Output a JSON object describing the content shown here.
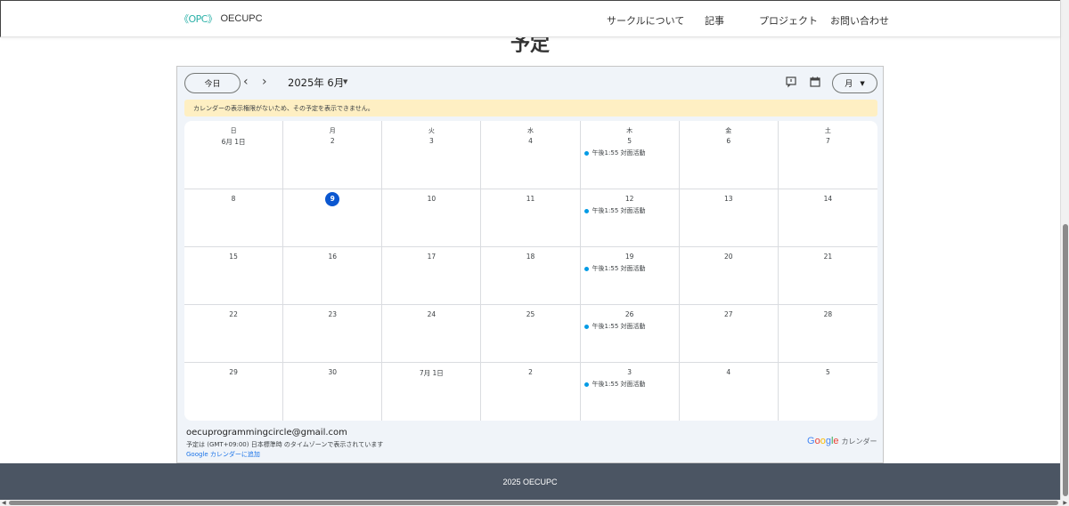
{
  "header": {
    "logo_mark": "《OPC》",
    "logo_text": "OECUPC",
    "nav": [
      "サークルについて",
      "記事",
      "プロジェクト",
      "お問い合わせ"
    ]
  },
  "page": {
    "heading": "予定"
  },
  "calendar": {
    "today_button": "今日",
    "month_label": "2025年 6月",
    "view_button": "月",
    "icons": {
      "prev": "chevron-left-icon",
      "next": "chevron-right-icon",
      "print": "feedback-icon",
      "calendar": "calendar-icon",
      "caret": "caret-down-icon"
    },
    "warning": "カレンダーの表示権限がないため、その予定を表示できません。",
    "weekdays": [
      "日",
      "月",
      "火",
      "水",
      "木",
      "金",
      "土"
    ],
    "weeks": [
      [
        {
          "day": "6月 1日",
          "event": null
        },
        {
          "day": "2",
          "event": null
        },
        {
          "day": "3",
          "event": null
        },
        {
          "day": "4",
          "event": null
        },
        {
          "day": "5",
          "event": "午後1:55 対面活動"
        },
        {
          "day": "6",
          "event": null
        },
        {
          "day": "7",
          "event": null
        }
      ],
      [
        {
          "day": "8",
          "event": null
        },
        {
          "day": "9",
          "event": null,
          "today": true
        },
        {
          "day": "10",
          "event": null
        },
        {
          "day": "11",
          "event": null
        },
        {
          "day": "12",
          "event": "午後1:55 対面活動"
        },
        {
          "day": "13",
          "event": null
        },
        {
          "day": "14",
          "event": null
        }
      ],
      [
        {
          "day": "15",
          "event": null
        },
        {
          "day": "16",
          "event": null
        },
        {
          "day": "17",
          "event": null
        },
        {
          "day": "18",
          "event": null
        },
        {
          "day": "19",
          "event": "午後1:55 対面活動"
        },
        {
          "day": "20",
          "event": null
        },
        {
          "day": "21",
          "event": null
        }
      ],
      [
        {
          "day": "22",
          "event": null
        },
        {
          "day": "23",
          "event": null
        },
        {
          "day": "24",
          "event": null
        },
        {
          "day": "25",
          "event": null
        },
        {
          "day": "26",
          "event": "午後1:55 対面活動"
        },
        {
          "day": "27",
          "event": null
        },
        {
          "day": "28",
          "event": null
        }
      ],
      [
        {
          "day": "29",
          "event": null
        },
        {
          "day": "30",
          "event": null
        },
        {
          "day": "7月 1日",
          "event": null
        },
        {
          "day": "2",
          "event": null
        },
        {
          "day": "3",
          "event": "午後1:55 対面活動"
        },
        {
          "day": "4",
          "event": null
        },
        {
          "day": "5",
          "event": null
        }
      ]
    ],
    "owner_email": "oecuprogrammingcircle@gmail.com",
    "timezone_note": "予定は (GMT+09:00) 日本標準時 のタイムゾーンで表示されています",
    "add_link": "Google カレンダーに追加",
    "brand": "Google",
    "brand_suffix": "カレンダー",
    "colors": {
      "event_dot": "#039be5",
      "today_circle": "#0b57d0",
      "warning_bg": "#feefc3"
    }
  },
  "footer": {
    "text": "2025 OECUPC"
  }
}
